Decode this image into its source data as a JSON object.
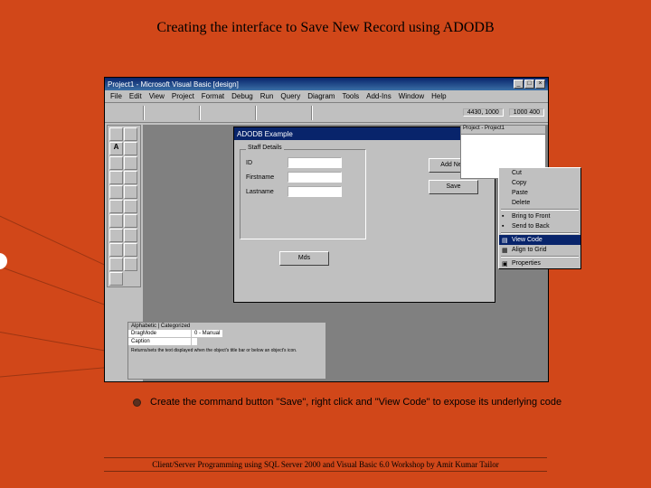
{
  "slide": {
    "title": "Creating the interface to Save New Record using ADODB",
    "instruction": "Create the command button \"Save\", right click and \"View Code\" to expose its underlying code",
    "footer": "Client/Server Programming using SQL Server 2000 and Visual Basic 6.0 Workshop by Amit Kumar Tailor"
  },
  "ide": {
    "title": "Project1 - Microsoft Visual Basic [design]",
    "menu": [
      "File",
      "Edit",
      "View",
      "Project",
      "Format",
      "Debug",
      "Run",
      "Query",
      "Diagram",
      "Tools",
      "Add-Ins",
      "Window",
      "Help"
    ],
    "coords1": "4430, 1000",
    "coords2": "1000  400"
  },
  "form": {
    "title": "ADODB Example",
    "frame": "Staff Details",
    "labels": {
      "id": "ID",
      "first": "Firstname",
      "last": "Lastname"
    },
    "buttons": {
      "addnew": "Add New",
      "save": "Save",
      "mds": "Mds"
    }
  },
  "contextMenu": {
    "cut": "Cut",
    "copy": "Copy",
    "paste": "Paste",
    "delete": "Delete",
    "bringfront": "Bring to Front",
    "sendback": "Send to Back",
    "viewcode": "View Code",
    "alignsize": "Align to Grid",
    "properties": "Properties"
  },
  "props": {
    "tab": "Alphabetic | Categorized",
    "r1k": "DragMode",
    "r1v": "0 - Manual",
    "r2k": "Caption",
    "r2v": "",
    "desc": "Returns/sets the text displayed when the object's title bar or below an object's icon."
  },
  "project": {
    "hdr": "Project - Project1"
  }
}
